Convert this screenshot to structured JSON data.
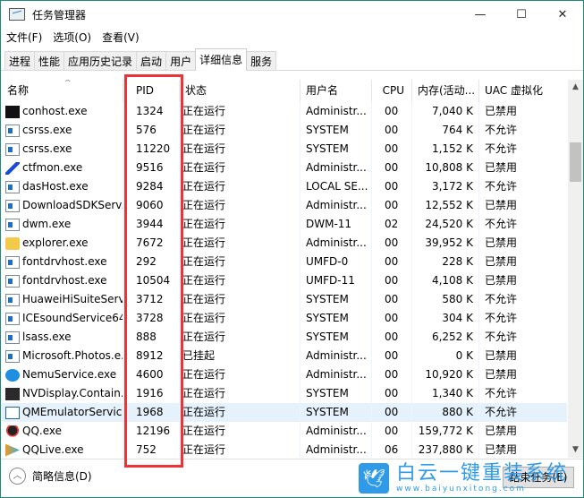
{
  "window": {
    "title": "任务管理器",
    "minimize": "—",
    "maximize": "☐",
    "close": "✕"
  },
  "menu": [
    "文件(F)",
    "选项(O)",
    "查看(V)"
  ],
  "tabs": [
    "进程",
    "性能",
    "应用历史记录",
    "启动",
    "用户",
    "详细信息",
    "服务"
  ],
  "active_tab": "详细信息",
  "columns": [
    "名称",
    "PID",
    "状态",
    "用户名",
    "CPU",
    "内存(活动...",
    "UAC 虚拟化"
  ],
  "sort_indicator": "^",
  "rows": [
    {
      "icon": "cmd",
      "name": "conhost.exe",
      "pid": "1324",
      "status": "正在运行",
      "user": "Administr...",
      "cpu": "00",
      "mem": "7,040 K",
      "uac": "已禁用"
    },
    {
      "icon": "std",
      "name": "csrss.exe",
      "pid": "576",
      "status": "正在运行",
      "user": "SYSTEM",
      "cpu": "00",
      "mem": "764 K",
      "uac": "不允许"
    },
    {
      "icon": "std",
      "name": "csrss.exe",
      "pid": "11220",
      "status": "正在运行",
      "user": "SYSTEM",
      "cpu": "00",
      "mem": "1,152 K",
      "uac": "不允许"
    },
    {
      "icon": "pen",
      "name": "ctfmon.exe",
      "pid": "9516",
      "status": "正在运行",
      "user": "Administr...",
      "cpu": "00",
      "mem": "10,808 K",
      "uac": "已禁用"
    },
    {
      "icon": "std",
      "name": "dasHost.exe",
      "pid": "9284",
      "status": "正在运行",
      "user": "LOCAL SE...",
      "cpu": "00",
      "mem": "3,172 K",
      "uac": "不允许"
    },
    {
      "icon": "std",
      "name": "DownloadSDKServ...",
      "pid": "9060",
      "status": "正在运行",
      "user": "Administr...",
      "cpu": "00",
      "mem": "12,552 K",
      "uac": "已禁用"
    },
    {
      "icon": "std",
      "name": "dwm.exe",
      "pid": "3944",
      "status": "正在运行",
      "user": "DWM-11",
      "cpu": "02",
      "mem": "24,520 K",
      "uac": "不允许"
    },
    {
      "icon": "folder",
      "name": "explorer.exe",
      "pid": "7672",
      "status": "正在运行",
      "user": "Administr...",
      "cpu": "00",
      "mem": "39,952 K",
      "uac": "已禁用"
    },
    {
      "icon": "std",
      "name": "fontdrvhost.exe",
      "pid": "292",
      "status": "正在运行",
      "user": "UMFD-0",
      "cpu": "00",
      "mem": "228 K",
      "uac": "已禁用"
    },
    {
      "icon": "std",
      "name": "fontdrvhost.exe",
      "pid": "10504",
      "status": "正在运行",
      "user": "UMFD-11",
      "cpu": "00",
      "mem": "4,108 K",
      "uac": "已禁用"
    },
    {
      "icon": "std",
      "name": "HuaweiHiSuiteServi...",
      "pid": "3712",
      "status": "正在运行",
      "user": "SYSTEM",
      "cpu": "00",
      "mem": "580 K",
      "uac": "不允许"
    },
    {
      "icon": "std",
      "name": "ICEsoundService64...",
      "pid": "3728",
      "status": "正在运行",
      "user": "SYSTEM",
      "cpu": "00",
      "mem": "304 K",
      "uac": "不允许"
    },
    {
      "icon": "std",
      "name": "lsass.exe",
      "pid": "888",
      "status": "正在运行",
      "user": "SYSTEM",
      "cpu": "00",
      "mem": "6,252 K",
      "uac": "不允许"
    },
    {
      "icon": "std",
      "name": "Microsoft.Photos.e...",
      "pid": "8912",
      "status": "已挂起",
      "user": "Administr...",
      "cpu": "00",
      "mem": "0 K",
      "uac": "已禁用"
    },
    {
      "icon": "nemu",
      "name": "NemuService.exe",
      "pid": "4600",
      "status": "正在运行",
      "user": "Administr...",
      "cpu": "00",
      "mem": "10,920 K",
      "uac": "已禁用"
    },
    {
      "icon": "nv",
      "name": "NVDisplay.Contain...",
      "pid": "1916",
      "status": "正在运行",
      "user": "SYSTEM",
      "cpu": "00",
      "mem": "1,340 K",
      "uac": "不允许"
    },
    {
      "icon": "qm",
      "name": "QMEmulatorServic...",
      "pid": "1968",
      "status": "正在运行",
      "user": "SYSTEM",
      "cpu": "00",
      "mem": "880 K",
      "uac": "不允许",
      "selected": true
    },
    {
      "icon": "qq",
      "name": "QQ.exe",
      "pid": "12196",
      "status": "正在运行",
      "user": "Administr...",
      "cpu": "00",
      "mem": "159,772 K",
      "uac": "已禁用"
    },
    {
      "icon": "qqlive",
      "name": "QQLive.exe",
      "pid": "752",
      "status": "正在运行",
      "user": "Administr...",
      "cpu": "06",
      "mem": "237,880 K",
      "uac": "已禁用"
    }
  ],
  "footer": {
    "fewer_details": "简略信息(D)",
    "end_task": "结束任务(E)"
  },
  "watermark": {
    "title": "白云一键重装系统",
    "url": "www.baiyunxitong.com"
  },
  "colors": {
    "highlight_box": "#ee3338",
    "selected_row": "#e5f1fb",
    "window_border": "#1f8a7c"
  }
}
